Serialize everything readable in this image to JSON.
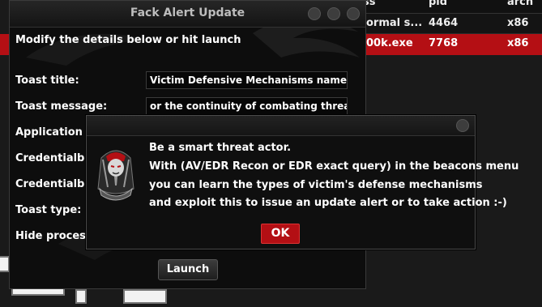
{
  "background_table": {
    "headers": [
      "ss",
      "pid",
      "arch"
    ],
    "rows": [
      {
        "process": "ormal s...",
        "pid": "4464",
        "arch": "x86"
      },
      {
        "process": "00k.exe",
        "pid": "7768",
        "arch": "x86"
      }
    ]
  },
  "dialog": {
    "title": "Fack Alert Update",
    "intro": "Modify the details below or hit launch",
    "fields": [
      {
        "label": "Toast title:",
        "value": "Victim Defensive Mechanisms name"
      },
      {
        "label": "Toast message:",
        "value": "or the continuity of combating threats"
      },
      {
        "label": "Application na",
        "value": ""
      },
      {
        "label": "Credentialbox",
        "value": ""
      },
      {
        "label": "Credentialbox",
        "value": ""
      },
      {
        "label": "Toast type:",
        "value": ""
      },
      {
        "label": "Hide processe",
        "value": ""
      }
    ],
    "launch_label": "Launch"
  },
  "popup": {
    "lines": [
      "Be a smart threat actor.",
      "With (AV/EDR Recon or EDR exact query) in the beacons menu",
      "you can learn the types of victim's defense mechanisms",
      "and exploit this to issue an update alert or to take action :-)"
    ],
    "ok_label": "OK",
    "icon": "pharaoh-icon"
  },
  "colors": {
    "accent_red": "#b40f14",
    "dialog_bg": "#0d0d0d"
  }
}
